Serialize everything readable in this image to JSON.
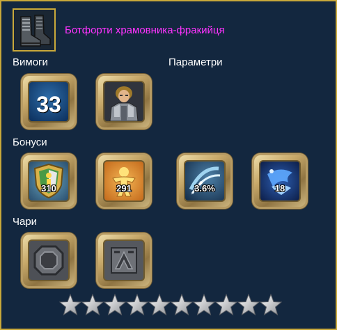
{
  "item": {
    "name": "Ботфорти храмовника-фракийця",
    "icon": "boots-icon",
    "name_color": "#ff33ff"
  },
  "sections": {
    "requirements_label": "Вимоги",
    "parameters_label": "Параметри",
    "bonuses_label": "Бонуси",
    "enchants_label": "Чари"
  },
  "requirements": {
    "level": "33",
    "character_icon": "knight-portrait-icon"
  },
  "bonuses": [
    {
      "icon": "shield-defense-icon",
      "value": "310"
    },
    {
      "icon": "vitality-figure-icon",
      "value": "291"
    },
    {
      "icon": "crit-strike-icon",
      "value": "3.6%"
    },
    {
      "icon": "water-vortex-icon",
      "value": "18"
    }
  ],
  "enchants": [
    {
      "icon": "stone-rune-octagon-icon"
    },
    {
      "icon": "stone-rune-angular-icon"
    }
  ],
  "rating": {
    "stars_total": 10,
    "stars_filled": 10
  },
  "colors": {
    "background": "#13273f",
    "frame_gold": "#c9a93a"
  }
}
